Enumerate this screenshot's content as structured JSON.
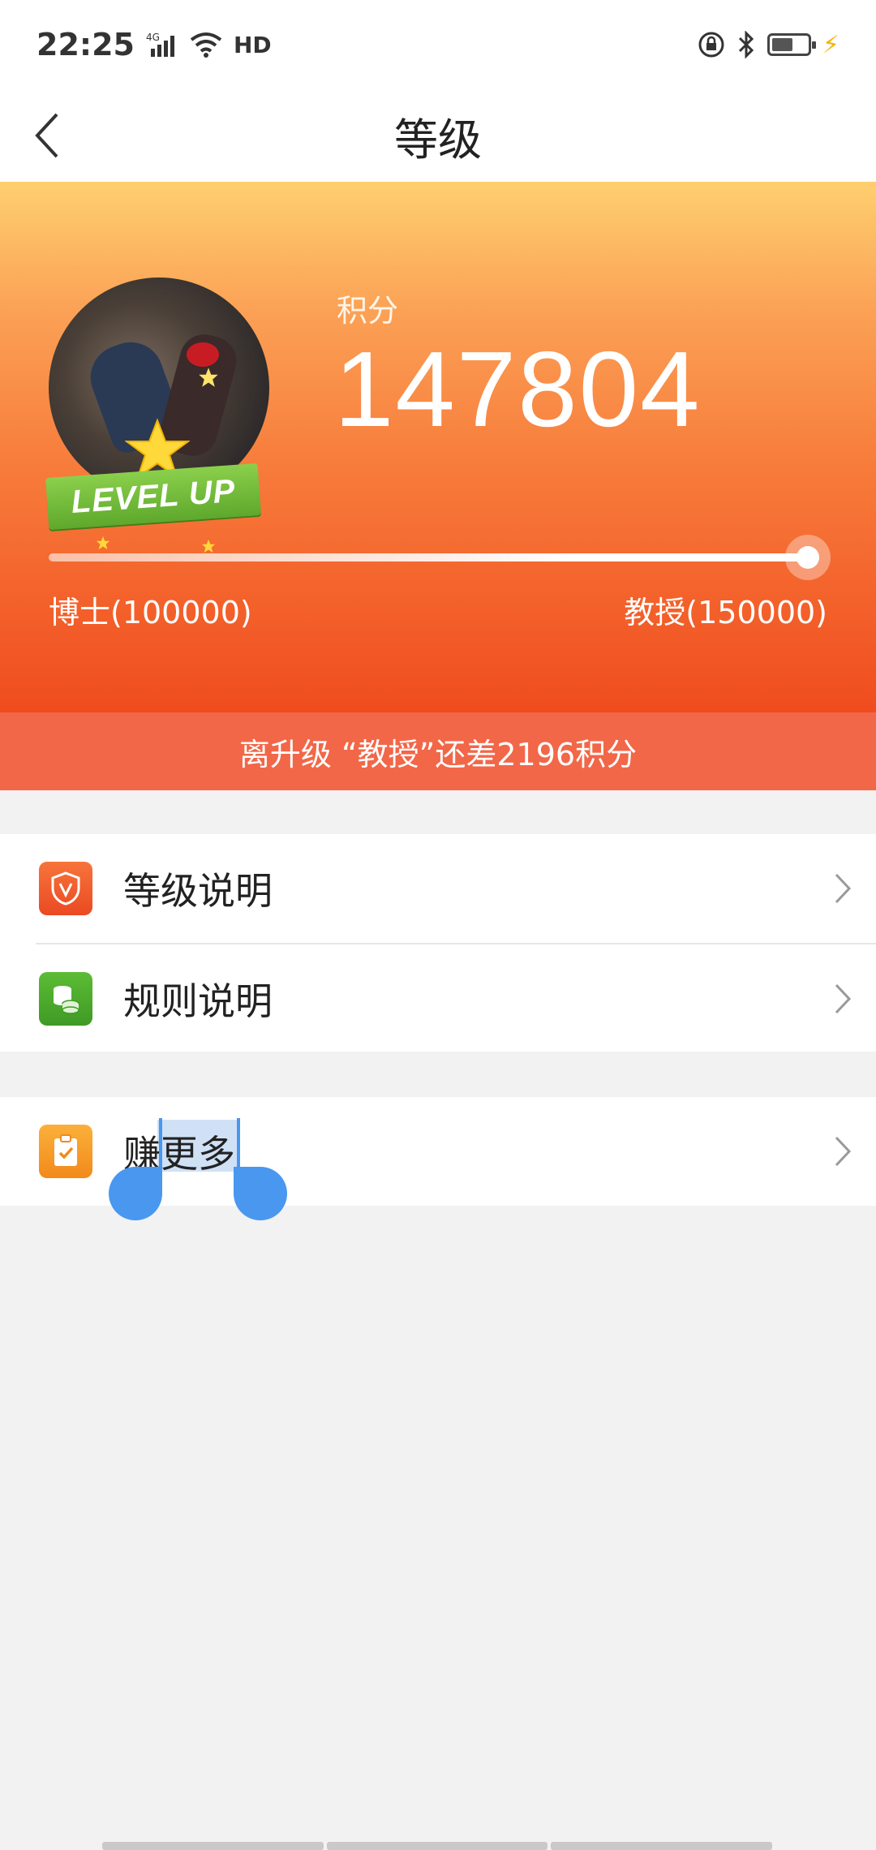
{
  "status_bar": {
    "time": "22:25",
    "network": "4G",
    "hd": "HD"
  },
  "nav": {
    "title": "等级"
  },
  "hero": {
    "score_label": "积分",
    "score_value": "147804",
    "badge_text": "LEVEL UP",
    "progress_fraction": 0.9856,
    "left_level": "博士(100000)",
    "right_level": "教授(150000)"
  },
  "tip": {
    "text": "离升级 “教授”还差2196积分"
  },
  "menu": {
    "items": [
      {
        "label": "等级说明",
        "icon": "shield-v-icon",
        "color": "#f0542a"
      },
      {
        "label": "规则说明",
        "icon": "coins-icon",
        "color": "#4aa32b"
      }
    ],
    "earn": {
      "label": "赚更多",
      "icon": "clipboard-check-icon",
      "color": "#f59620"
    }
  },
  "colors": {
    "hero_top": "#fecf6f",
    "hero_bottom": "#f04c1e",
    "tip_bg": "#f26748",
    "selection": "#4a97f0"
  }
}
